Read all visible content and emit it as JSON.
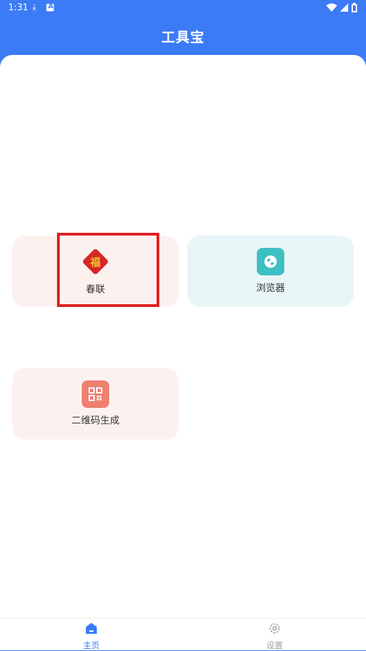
{
  "status": {
    "time": "1:31",
    "download_glyph": "⤓",
    "a_glyph": "A"
  },
  "header": {
    "title": "工具宝"
  },
  "tools": [
    {
      "label": "春联",
      "icon": "fu-icon",
      "icon_glyph": "福"
    },
    {
      "label": "浏览器",
      "icon": "globe-icon"
    },
    {
      "label": "二维码生成",
      "icon": "qrcode-icon"
    }
  ],
  "nav": {
    "home_label": "主页",
    "settings_label": "设置"
  },
  "colors": {
    "header_bg": "#3B7BF6",
    "active_nav": "#3B7BF6",
    "inactive_nav": "#9AA0A6",
    "pink_tile": "#FDF1F0",
    "cyan_tile": "#E9F6F7",
    "highlight_border": "#E02020"
  }
}
